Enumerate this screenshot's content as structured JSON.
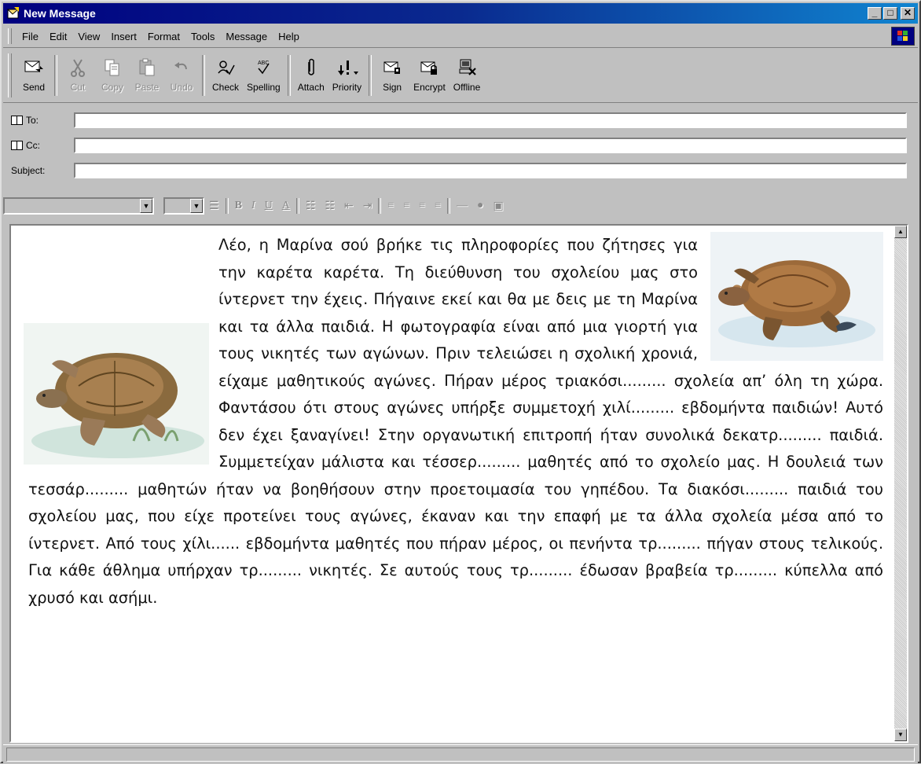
{
  "window": {
    "title": "New Message"
  },
  "menu": [
    "File",
    "Edit",
    "View",
    "Insert",
    "Format",
    "Tools",
    "Message",
    "Help"
  ],
  "toolbar": [
    {
      "label": "Send",
      "icon": "send-icon",
      "enabled": true
    },
    {
      "label": "Cut",
      "icon": "cut-icon",
      "enabled": false
    },
    {
      "label": "Copy",
      "icon": "copy-icon",
      "enabled": false
    },
    {
      "label": "Paste",
      "icon": "paste-icon",
      "enabled": false
    },
    {
      "label": "Undo",
      "icon": "undo-icon",
      "enabled": false
    },
    {
      "label": "Check",
      "icon": "check-names-icon",
      "enabled": true
    },
    {
      "label": "Spelling",
      "icon": "spelling-icon",
      "enabled": true
    },
    {
      "label": "Attach",
      "icon": "paperclip-icon",
      "enabled": true
    },
    {
      "label": "Priority",
      "icon": "priority-icon",
      "enabled": true
    },
    {
      "label": "Sign",
      "icon": "sign-icon",
      "enabled": true
    },
    {
      "label": "Encrypt",
      "icon": "encrypt-icon",
      "enabled": true
    },
    {
      "label": "Offline",
      "icon": "offline-icon",
      "enabled": true
    }
  ],
  "fields": {
    "to_label": "To:",
    "cc_label": "Cc:",
    "subject_label": "Subject:",
    "to_value": "",
    "cc_value": "",
    "subject_value": ""
  },
  "format_bar": {
    "font": "",
    "size": "",
    "bold": "B",
    "italic": "I",
    "underline": "U",
    "font_color": "A"
  },
  "body": {
    "paragraph1": "Λέο, η Μαρίνα σού βρήκε τις πληροφορίες που ζήτησες για την καρέτα καρέτα. Τη διεύθυνση του σχολείου μας στο ίντερνετ την έχεις. Πήγαινε εκεί και θα με δεις με τη Μαρίνα και τα άλλα παιδιά. Η φωτογραφία είναι από μια γιορτή για τους νικητές των αγώνων. Πριν τελειώσει η σχολική χρονιά, είχαμε μαθητικούς αγώνες. Πήραν μέρος τριακόσι......... σχολεία απ’ όλη τη χώρα. Φαντάσου ότι στους αγώνες υπήρξε συμμετοχή χιλί......... εβδομήντα παιδιών! Αυτό δεν έχει ξαναγίνει! Στην οργανωτική επιτροπή ήταν συνολικά δεκατρ......... παιδιά. Συμμετείχαν μάλιστα και τέσσερ......... μαθητές από το σχολείο μας. Η δουλειά των τεσσάρ......... μαθητών ήταν να βοηθήσουν στην προετοιμασία του γηπέδου. Τα διακόσι......... παιδιά του σχολείου μας, που είχε προτείνει τους αγώνες, έκαναν και την επαφή με τα άλλα σχολεία μέσα από το ίντερνετ. Από τους χίλι...... εβδομήντα μαθητές που πήραν μέρος, οι πενήντα τρ......... πήγαν στους τελικούς. Για κάθε άθλημα υπήρχαν τρ......... νικητές. Σε αυτούς τους τρ......... έδωσαν βραβεία τρ......... κύπελλα από χρυσό και ασήμι."
  },
  "colors": {
    "titlebar": "#000080",
    "chrome": "#c0c0c0",
    "turtle_shell": "#9c6a3a"
  }
}
